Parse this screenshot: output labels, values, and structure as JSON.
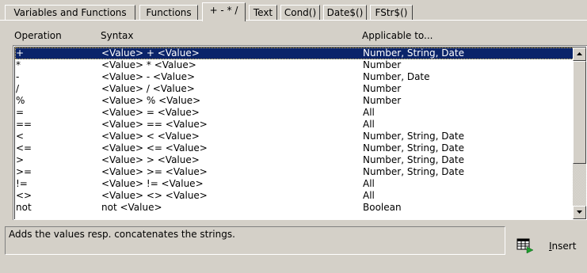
{
  "tabs": [
    {
      "label": "Variables and Functions",
      "active": false
    },
    {
      "label": "Functions",
      "active": false
    },
    {
      "label": "+ - * /",
      "active": true
    },
    {
      "label": "Text",
      "active": false
    },
    {
      "label": "Cond()",
      "active": false
    },
    {
      "label": "Date$()",
      "active": false
    },
    {
      "label": "FStr$()",
      "active": false
    }
  ],
  "columns": {
    "operation": "Operation",
    "syntax": "Syntax",
    "applicable": "Applicable to..."
  },
  "rows": [
    {
      "op": "+",
      "syntax": "<Value> + <Value>",
      "applicable": "Number, String, Date",
      "selected": true
    },
    {
      "op": "*",
      "syntax": "<Value> * <Value>",
      "applicable": "Number"
    },
    {
      "op": "-",
      "syntax": "<Value> - <Value>",
      "applicable": "Number, Date"
    },
    {
      "op": "/",
      "syntax": "<Value> / <Value>",
      "applicable": "Number"
    },
    {
      "op": "%",
      "syntax": "<Value> % <Value>",
      "applicable": "Number"
    },
    {
      "op": "=",
      "syntax": "<Value> = <Value>",
      "applicable": "All"
    },
    {
      "op": "==",
      "syntax": "<Value> == <Value>",
      "applicable": "All"
    },
    {
      "op": "<",
      "syntax": "<Value> < <Value>",
      "applicable": "Number, String, Date"
    },
    {
      "op": "<=",
      "syntax": "<Value> <= <Value>",
      "applicable": "Number, String, Date"
    },
    {
      "op": ">",
      "syntax": "<Value> > <Value>",
      "applicable": "Number, String, Date"
    },
    {
      "op": ">=",
      "syntax": "<Value> >= <Value>",
      "applicable": "Number, String, Date"
    },
    {
      "op": "!=",
      "syntax": "<Value> != <Value>",
      "applicable": "All"
    },
    {
      "op": "<>",
      "syntax": "<Value> <> <Value>",
      "applicable": "All"
    },
    {
      "op": "not",
      "syntax": "not <Value>",
      "applicable": "Boolean"
    }
  ],
  "description": "Adds the values resp. concatenates the strings.",
  "insert_button": {
    "label": "Insert",
    "icon": "insert-table-icon"
  },
  "colors": {
    "selection": "#0a246a",
    "face": "#d4d0c8"
  }
}
